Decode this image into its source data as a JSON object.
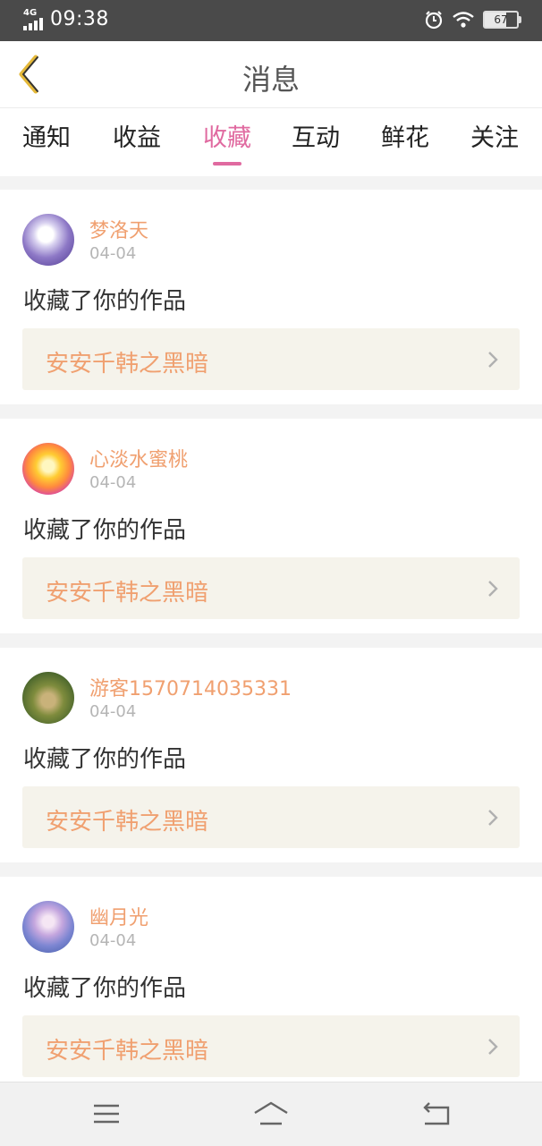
{
  "status_bar": {
    "network": "4G",
    "time": "09:38",
    "battery": "67",
    "icons": [
      "signal-icon",
      "alarm-icon",
      "wifi-icon",
      "battery-icon"
    ]
  },
  "header": {
    "title": "消息",
    "back_icon": "chevron-left-icon"
  },
  "tabs": [
    {
      "label": "通知",
      "active": false
    },
    {
      "label": "收益",
      "active": false
    },
    {
      "label": "收藏",
      "active": true
    },
    {
      "label": "互动",
      "active": false
    },
    {
      "label": "鲜花",
      "active": false
    },
    {
      "label": "关注",
      "active": false
    }
  ],
  "messages": [
    {
      "user": "梦洛天",
      "date": "04-04",
      "action": "收藏了你的作品",
      "work": "安安千韩之黑暗"
    },
    {
      "user": "心淡水蜜桃",
      "date": "04-04",
      "action": "收藏了你的作品",
      "work": "安安千韩之黑暗"
    },
    {
      "user": "游客1570714035331",
      "date": "04-04",
      "action": "收藏了你的作品",
      "work": "安安千韩之黑暗"
    },
    {
      "user": "幽月光",
      "date": "04-04",
      "action": "收藏了你的作品",
      "work": "安安千韩之黑暗"
    }
  ],
  "nav_bar": {
    "icons": [
      "menu-icon",
      "home-icon",
      "back-icon"
    ]
  },
  "colors": {
    "accent": "#e06aa0",
    "username": "#f0a070",
    "work_bg": "#f5f3eb",
    "status_bar": "#4a4a4a"
  }
}
